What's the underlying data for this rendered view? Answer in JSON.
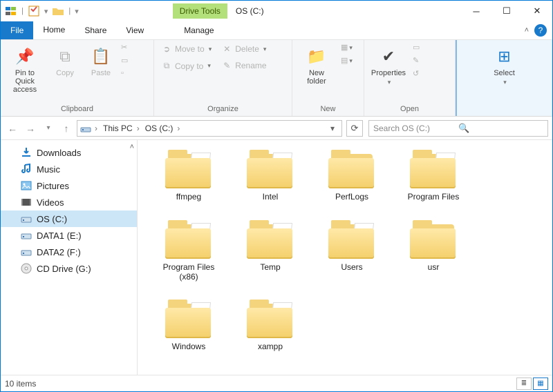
{
  "title": "OS (C:)",
  "tool_tab": "Drive Tools",
  "tabs": {
    "file": "File",
    "home": "Home",
    "share": "Share",
    "view": "View",
    "manage": "Manage"
  },
  "ribbon": {
    "pin": "Pin to Quick\naccess",
    "copy": "Copy",
    "paste": "Paste",
    "clipboard_label": "Clipboard",
    "move_to": "Move to",
    "copy_to": "Copy to",
    "delete": "Delete",
    "rename": "Rename",
    "organize_label": "Organize",
    "new_folder": "New\nfolder",
    "new_label": "New",
    "properties": "Properties",
    "open_label": "Open",
    "select": "Select"
  },
  "breadcrumb": [
    "This PC",
    "OS (C:)"
  ],
  "search_placeholder": "Search OS (C:)",
  "tree": [
    {
      "icon": "download",
      "label": "Downloads"
    },
    {
      "icon": "music",
      "label": "Music"
    },
    {
      "icon": "pictures",
      "label": "Pictures"
    },
    {
      "icon": "videos",
      "label": "Videos"
    },
    {
      "icon": "drive",
      "label": "OS (C:)",
      "selected": true
    },
    {
      "icon": "drive",
      "label": "DATA1 (E:)"
    },
    {
      "icon": "drive",
      "label": "DATA2 (F:)"
    },
    {
      "icon": "cd",
      "label": "CD Drive (G:)"
    }
  ],
  "folders": [
    {
      "name": "ffmpeg",
      "variant": "green"
    },
    {
      "name": "Intel",
      "variant": "sheet"
    },
    {
      "name": "PerfLogs",
      "variant": "plain"
    },
    {
      "name": "Program Files",
      "variant": "sheet"
    },
    {
      "name": "Program Files (x86)",
      "variant": "sheet"
    },
    {
      "name": "Temp",
      "variant": "green"
    },
    {
      "name": "Users",
      "variant": "sheet"
    },
    {
      "name": "usr",
      "variant": "plain"
    },
    {
      "name": "Windows",
      "variant": "sheet"
    },
    {
      "name": "xampp",
      "variant": "sheet"
    }
  ],
  "status": "10 items"
}
